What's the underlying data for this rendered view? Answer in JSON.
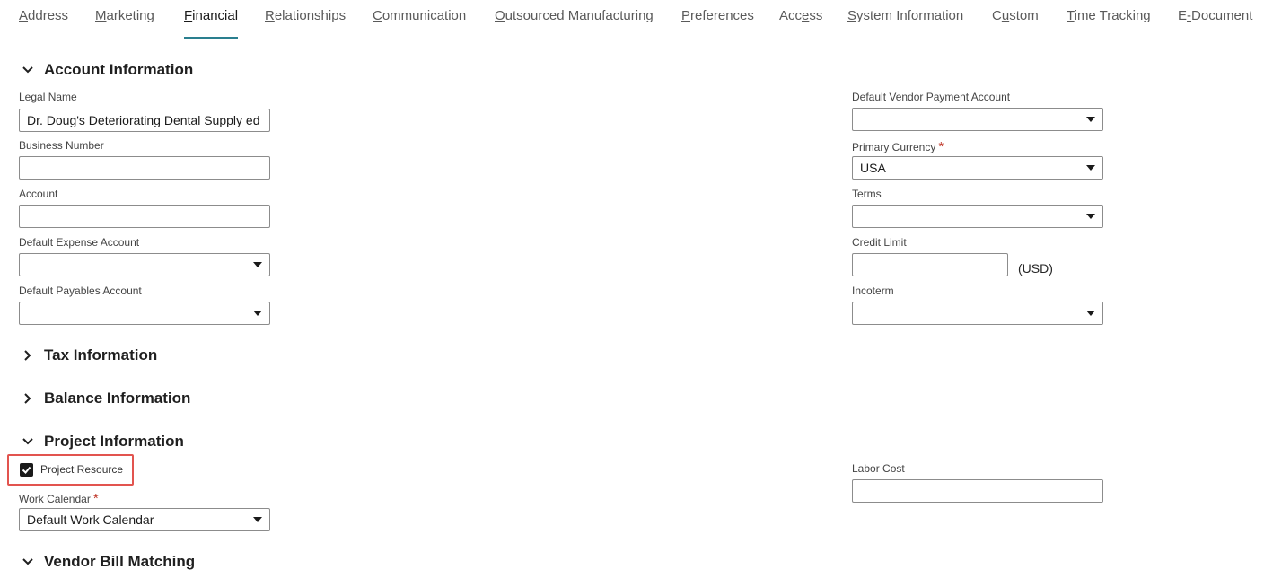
{
  "tabs": [
    {
      "pre": "",
      "mn": "A",
      "post": "ddress"
    },
    {
      "pre": "",
      "mn": "M",
      "post": "arketing"
    },
    {
      "pre": "",
      "mn": "F",
      "post": "inancial"
    },
    {
      "pre": "",
      "mn": "R",
      "post": "elationships"
    },
    {
      "pre": "",
      "mn": "C",
      "post": "ommunication"
    },
    {
      "pre": "",
      "mn": "O",
      "post": "utsourced Manufacturing"
    },
    {
      "pre": "",
      "mn": "P",
      "post": "references"
    },
    {
      "pre": "Acc",
      "mn": "e",
      "post": "ss"
    },
    {
      "pre": "",
      "mn": "S",
      "post": "ystem Information"
    },
    {
      "pre": "C",
      "mn": "u",
      "post": "stom"
    },
    {
      "pre": "",
      "mn": "T",
      "post": "ime Tracking"
    },
    {
      "pre": "E",
      "mn": "-",
      "post": "Document"
    }
  ],
  "active_tab": "Financial",
  "sections": {
    "account": "Account Information",
    "tax": "Tax Information",
    "balance": "Balance Information",
    "project": "Project Information",
    "vendor_bill": "Vendor Bill Matching"
  },
  "account": {
    "legal_name_label": "Legal Name",
    "legal_name_value": "Dr. Doug's Deteriorating Dental Supply ed",
    "business_number_label": "Business Number",
    "business_number_value": "",
    "account_label": "Account",
    "account_value": "",
    "default_expense_label": "Default Expense Account",
    "default_expense_value": "",
    "default_payables_label": "Default Payables Account",
    "default_payables_value": "",
    "default_vendor_payment_label": "Default Vendor Payment Account",
    "default_vendor_payment_value": "",
    "primary_currency_label": "Primary Currency",
    "primary_currency_value": "USA",
    "terms_label": "Terms",
    "terms_value": "",
    "credit_limit_label": "Credit Limit",
    "credit_limit_value": "",
    "credit_limit_unit": "(USD)",
    "incoterm_label": "Incoterm",
    "incoterm_value": ""
  },
  "project": {
    "project_resource_label": "Project Resource",
    "project_resource_checked": true,
    "work_calendar_label": "Work Calendar",
    "work_calendar_value": "Default Work Calendar",
    "labor_cost_label": "Labor Cost",
    "labor_cost_value": ""
  },
  "required_marker": "*",
  "colors": {
    "accent": "#2a7f8f",
    "required": "#c0392b",
    "highlight": "#e2544f"
  }
}
